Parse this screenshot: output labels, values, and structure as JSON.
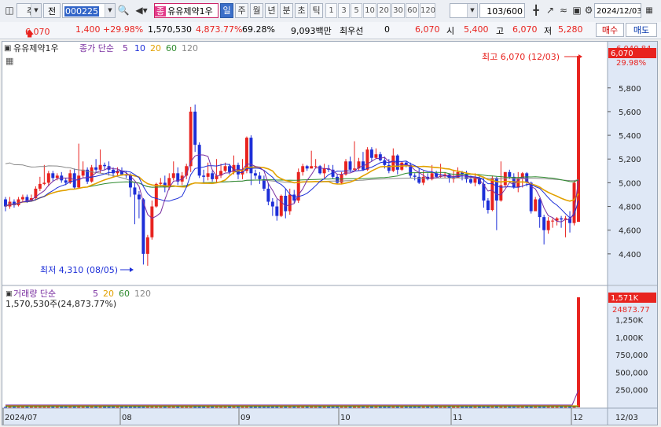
{
  "toolbar": {
    "market": "주",
    "type": "전",
    "code": "000225",
    "name_badge": "종",
    "name": "유유제약1우",
    "period_tabs": [
      "일",
      "주",
      "월",
      "년",
      "분",
      "초",
      "틱"
    ],
    "minute_options": [
      "1",
      "3",
      "5",
      "10",
      "20",
      "30",
      "60",
      "120"
    ],
    "count": "103",
    "count_total": "/600",
    "date": "2024/12/03"
  },
  "quote": {
    "price": "6,070",
    "change": "1,400",
    "change_rate": "+29.98%",
    "volume": "1,570,530",
    "volume_rate": "4,873.77%",
    "turnover_rate": "69.28%",
    "amount": "9,093백만",
    "order_label": "최우선",
    "order_value": "0",
    "ask": "6,070",
    "open_label": "시",
    "open": "5,400",
    "high_label": "고",
    "high": "6,070",
    "low_label": "저",
    "low": "5,280",
    "buy_label": "매수",
    "sell_label": "매도"
  },
  "colors": {
    "up": "#e8231f",
    "down": "#1d2fd8",
    "ma5": "#7a2fa0",
    "ma10": "#1d2fd8",
    "ma20": "#e2a100",
    "ma60": "#2e8b2e",
    "ma120": "#888888",
    "current_bg": "#e8231f"
  },
  "chart_data": {
    "type": "candlestick",
    "title": "유유제약1우",
    "x_axis_labels": [
      "2024/07",
      "08",
      "09",
      "10",
      "11",
      "12",
      "12/03"
    ],
    "price_pane": {
      "legend": {
        "label": "종가 단순",
        "periods": [
          "5",
          "10",
          "20",
          "60",
          "120"
        ]
      },
      "y_ticks": [
        "6,040.84",
        "29.98%",
        "5,800",
        "5,600",
        "5,400",
        "5,200",
        "5,000",
        "4,800",
        "4,600",
        "4,400"
      ],
      "current_value": "6,070",
      "ylim": [
        4200,
        6150
      ],
      "annotations": {
        "high": "최고 6,070 (12/03)",
        "low": "최저 4,310 (08/05)"
      },
      "candles": [
        [
          4860,
          4800,
          4880,
          4760
        ],
        [
          4800,
          4840,
          4880,
          4780
        ],
        [
          4840,
          4810,
          4860,
          4790
        ],
        [
          4810,
          4860,
          4880,
          4800
        ],
        [
          4860,
          4880,
          4900,
          4840
        ],
        [
          4880,
          4850,
          4900,
          4830
        ],
        [
          4850,
          4870,
          4900,
          4840
        ],
        [
          4870,
          4950,
          4970,
          4850
        ],
        [
          4950,
          4990,
          5050,
          4930
        ],
        [
          4990,
          5000,
          5150,
          4980
        ],
        [
          5000,
          5080,
          5100,
          4970
        ],
        [
          5080,
          5040,
          5100,
          5010
        ],
        [
          5040,
          5060,
          5080,
          5020
        ],
        [
          5060,
          5020,
          5090,
          5000
        ],
        [
          5020,
          5000,
          5040,
          4980
        ],
        [
          5000,
          5080,
          5110,
          4990
        ],
        [
          5080,
          4960,
          5120,
          4950
        ],
        [
          4960,
          5060,
          5330,
          4950
        ],
        [
          5060,
          5110,
          5180,
          5040
        ],
        [
          5110,
          5010,
          5130,
          4990
        ],
        [
          5010,
          5130,
          5150,
          5000
        ],
        [
          5130,
          5110,
          5200,
          5090
        ],
        [
          5110,
          5150,
          5280,
          5080
        ],
        [
          5150,
          5140,
          5170,
          5110
        ],
        [
          5140,
          5110,
          5180,
          5060
        ],
        [
          5110,
          5080,
          5130,
          5050
        ],
        [
          5080,
          5100,
          5130,
          5060
        ],
        [
          5100,
          5070,
          5130,
          5060
        ],
        [
          5070,
          5060,
          5100,
          5040
        ],
        [
          5060,
          4960,
          5080,
          4880
        ],
        [
          4960,
          4900,
          5000,
          4650
        ],
        [
          4900,
          4860,
          4930,
          4700
        ],
        [
          4860,
          4400,
          4870,
          4310
        ],
        [
          4400,
          4540,
          4560,
          4300
        ],
        [
          4540,
          4800,
          4850,
          4520
        ],
        [
          4800,
          4990,
          5000,
          4790
        ],
        [
          4990,
          5000,
          5040,
          4970
        ],
        [
          5000,
          4960,
          5060,
          4920
        ],
        [
          4960,
          5040,
          5080,
          4940
        ],
        [
          5040,
          5080,
          5180,
          5020
        ],
        [
          5080,
          5010,
          5130,
          4980
        ],
        [
          5010,
          5060,
          5090,
          4980
        ],
        [
          5060,
          5140,
          5160,
          5030
        ],
        [
          5140,
          5600,
          5640,
          5090
        ],
        [
          5600,
          5320,
          5660,
          5260
        ],
        [
          5320,
          5060,
          5340,
          5040
        ],
        [
          5060,
          5050,
          5110,
          5000
        ],
        [
          5050,
          5080,
          5170,
          5020
        ],
        [
          5080,
          5030,
          5100,
          5010
        ],
        [
          5030,
          5060,
          5200,
          5000
        ],
        [
          5060,
          5100,
          5160,
          5040
        ],
        [
          5100,
          5140,
          5170,
          5090
        ],
        [
          5140,
          5090,
          5160,
          5070
        ],
        [
          5090,
          5150,
          5230,
          5070
        ],
        [
          5150,
          5070,
          5170,
          5030
        ],
        [
          5070,
          5100,
          5200,
          5030
        ],
        [
          5100,
          5380,
          5390,
          5080
        ],
        [
          5380,
          5080,
          5400,
          4980
        ],
        [
          5080,
          5060,
          5110,
          5030
        ],
        [
          5060,
          5030,
          5090,
          4990
        ],
        [
          5030,
          4950,
          5060,
          4930
        ],
        [
          4950,
          4840,
          5000,
          4810
        ],
        [
          4840,
          4800,
          4870,
          4720
        ],
        [
          4800,
          4720,
          4860,
          4680
        ],
        [
          4720,
          4890,
          4900,
          4710
        ],
        [
          4890,
          4760,
          4950,
          4700
        ],
        [
          4760,
          4900,
          4950,
          4730
        ],
        [
          4900,
          4850,
          4940,
          4830
        ],
        [
          4850,
          5090,
          5120,
          4830
        ],
        [
          5090,
          5140,
          5160,
          5060
        ],
        [
          5140,
          5120,
          5150,
          5100
        ],
        [
          5120,
          5140,
          5270,
          5120
        ],
        [
          5140,
          5140,
          5200,
          5120
        ],
        [
          5140,
          5080,
          5150,
          5070
        ],
        [
          5080,
          5120,
          5160,
          5040
        ],
        [
          5120,
          5110,
          5150,
          5090
        ],
        [
          5110,
          5050,
          5150,
          5030
        ],
        [
          5050,
          5000,
          5070,
          4990
        ],
        [
          5000,
          5070,
          5090,
          4990
        ],
        [
          5070,
          5180,
          5200,
          5060
        ],
        [
          5180,
          5110,
          5220,
          5090
        ],
        [
          5110,
          5120,
          5350,
          5100
        ],
        [
          5120,
          5180,
          5210,
          5100
        ],
        [
          5180,
          5110,
          5260,
          5100
        ],
        [
          5110,
          5280,
          5300,
          5100
        ],
        [
          5280,
          5210,
          5300,
          5180
        ],
        [
          5210,
          5240,
          5290,
          5200
        ],
        [
          5240,
          5190,
          5260,
          5180
        ],
        [
          5190,
          5150,
          5220,
          5120
        ],
        [
          5150,
          5100,
          5200,
          5080
        ],
        [
          5100,
          5230,
          5290,
          5090
        ],
        [
          5230,
          5110,
          5240,
          5070
        ],
        [
          5110,
          5170,
          5180,
          5100
        ],
        [
          5170,
          5150,
          5180,
          5130
        ],
        [
          5150,
          5060,
          5170,
          5040
        ],
        [
          5060,
          5050,
          5080,
          5020
        ],
        [
          5050,
          5000,
          5120,
          4990
        ],
        [
          5000,
          5050,
          5100,
          4980
        ],
        [
          5050,
          5030,
          5080,
          5020
        ],
        [
          5030,
          5080,
          5150,
          5020
        ],
        [
          5080,
          5050,
          5100,
          5040
        ],
        [
          5050,
          5060,
          5160,
          5040
        ],
        [
          5060,
          5070,
          5090,
          5040
        ],
        [
          5070,
          5040,
          5080,
          5000
        ],
        [
          5040,
          5040,
          5110,
          5000
        ],
        [
          5040,
          5090,
          5130,
          5040
        ],
        [
          5090,
          5070,
          5100,
          5020
        ],
        [
          5070,
          5030,
          5100,
          5000
        ],
        [
          5030,
          5000,
          5060,
          4990
        ],
        [
          5000,
          5040,
          5080,
          4970
        ],
        [
          5040,
          4990,
          5060,
          4980
        ],
        [
          4990,
          4850,
          5040,
          4790
        ],
        [
          4850,
          4770,
          4870,
          4740
        ],
        [
          4770,
          5040,
          5060,
          4760
        ],
        [
          5040,
          4850,
          5050,
          4600
        ],
        [
          4850,
          4980,
          5180,
          4840
        ],
        [
          4980,
          5090,
          5090,
          4960
        ],
        [
          5090,
          5050,
          5110,
          5030
        ],
        [
          5050,
          4960,
          5080,
          4950
        ],
        [
          4960,
          5040,
          5090,
          4920
        ],
        [
          5040,
          5080,
          5090,
          4960
        ],
        [
          5080,
          5000,
          5090,
          4970
        ],
        [
          5000,
          4760,
          5010,
          4740
        ],
        [
          4760,
          4860,
          4880,
          4820
        ],
        [
          4860,
          4710,
          4870,
          4620
        ],
        [
          4710,
          4600,
          4730,
          4480
        ],
        [
          4600,
          4680,
          4710,
          4570
        ],
        [
          4680,
          4680,
          4700,
          4620
        ],
        [
          4680,
          4700,
          4710,
          4640
        ],
        [
          4700,
          4690,
          4720,
          4620
        ],
        [
          4690,
          4700,
          4720,
          4540
        ],
        [
          4700,
          4660,
          4760,
          4580
        ],
        [
          4660,
          5000,
          5020,
          4640
        ],
        [
          4670,
          6070,
          6070,
          5280
        ]
      ]
    },
    "volume_pane": {
      "legend": {
        "label": "거래량 단순",
        "periods": [
          "5",
          "20",
          "60",
          "120"
        ]
      },
      "volume_text": "1,570,530주(24,873.77%)",
      "y_ticks": [
        "1,571K",
        "24873.77",
        "1,250K",
        "1,000K",
        "750,000",
        "500,000",
        "250,000"
      ],
      "current_value": "1,571K",
      "ylim": [
        0,
        1650000
      ],
      "last_volume": 1570530,
      "base_volume": 6300
    }
  }
}
